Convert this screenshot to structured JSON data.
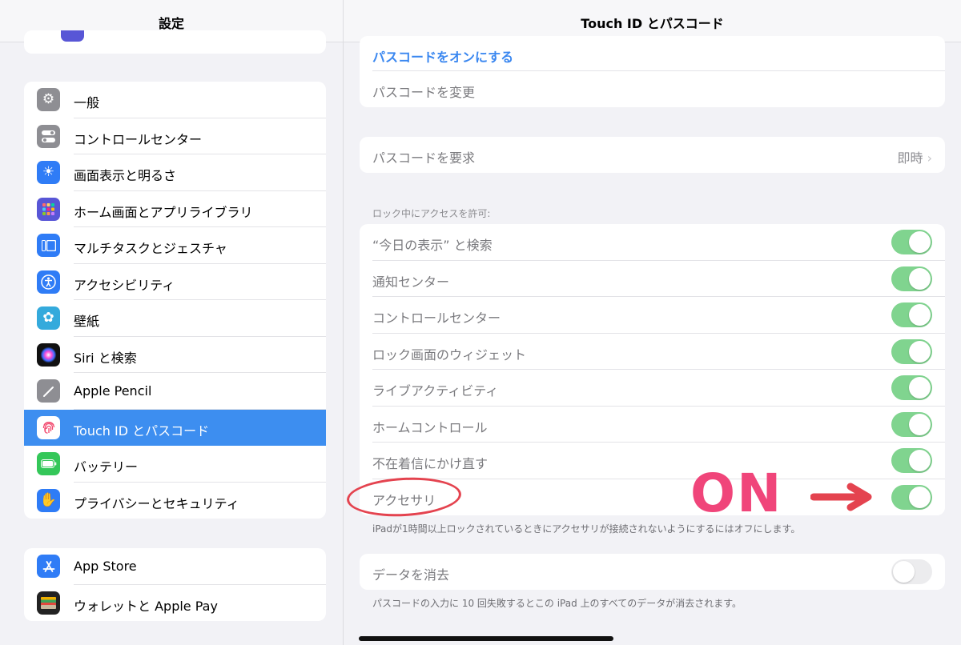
{
  "sidebar": {
    "title": "設定",
    "groups": [
      {
        "items": [
          {
            "label": "一般",
            "icon": "gear-icon",
            "color": "#8e8e93"
          },
          {
            "label": "コントロールセンター",
            "icon": "switches-icon",
            "color": "#8e8e93"
          },
          {
            "label": "画面表示と明るさ",
            "icon": "sun-icon",
            "color": "#2f7cf6"
          },
          {
            "label": "ホーム画面とアプリライブラリ",
            "icon": "app-grid-icon",
            "color": "#5856d6"
          },
          {
            "label": "マルチタスクとジェスチャ",
            "icon": "multitask-icon",
            "color": "#2f7cf6"
          },
          {
            "label": "アクセシビリティ",
            "icon": "accessibility-icon",
            "color": "#2f7cf6"
          },
          {
            "label": "壁紙",
            "icon": "flower-icon",
            "color": "#34aadc"
          },
          {
            "label": "Siri と検索",
            "icon": "siri-icon",
            "color": "#222222"
          },
          {
            "label": "Apple Pencil",
            "icon": "pencil-icon",
            "color": "#8e8e93"
          },
          {
            "label": "Touch ID とパスコード",
            "icon": "fingerprint-icon",
            "color": "#ffffff",
            "selected": true
          },
          {
            "label": "バッテリー",
            "icon": "battery-icon",
            "color": "#34c759"
          },
          {
            "label": "プライバシーとセキュリティ",
            "icon": "hand-icon",
            "color": "#2f7cf6"
          }
        ]
      },
      {
        "items": [
          {
            "label": "App Store",
            "icon": "app-store-icon",
            "color": "#2f7cf6"
          },
          {
            "label": "ウォレットと Apple Pay",
            "icon": "wallet-icon",
            "color": "#222222"
          }
        ]
      }
    ]
  },
  "detail": {
    "title": "Touch ID とパスコード",
    "passcode_on": "パスコードをオンにする",
    "passcode_change": "パスコードを変更",
    "require_label": "パスコードを要求",
    "require_value": "即時",
    "lock_header": "ロック中にアクセスを許可:",
    "toggles": [
      {
        "label": "“今日の表示” と検索",
        "on": true
      },
      {
        "label": "通知センター",
        "on": true
      },
      {
        "label": "コントロールセンター",
        "on": true
      },
      {
        "label": "ロック画面のウィジェット",
        "on": true
      },
      {
        "label": "ライブアクティビティ",
        "on": true
      },
      {
        "label": "ホームコントロール",
        "on": true
      },
      {
        "label": "不在着信にかけ直す",
        "on": true
      },
      {
        "label": "アクセサリ",
        "on": true
      }
    ],
    "accessory_note": "iPadが1時間以上ロックされているときにアクセサリが接続されないようにするにはオフにします。",
    "erase_label": "データを消去",
    "erase_on": false,
    "erase_note": "パスコードの入力に 10 回失敗するとこの iPad 上のすべてのデータが消去されます。"
  },
  "annotation": {
    "on_text": "ON",
    "color": "#f0457a"
  }
}
